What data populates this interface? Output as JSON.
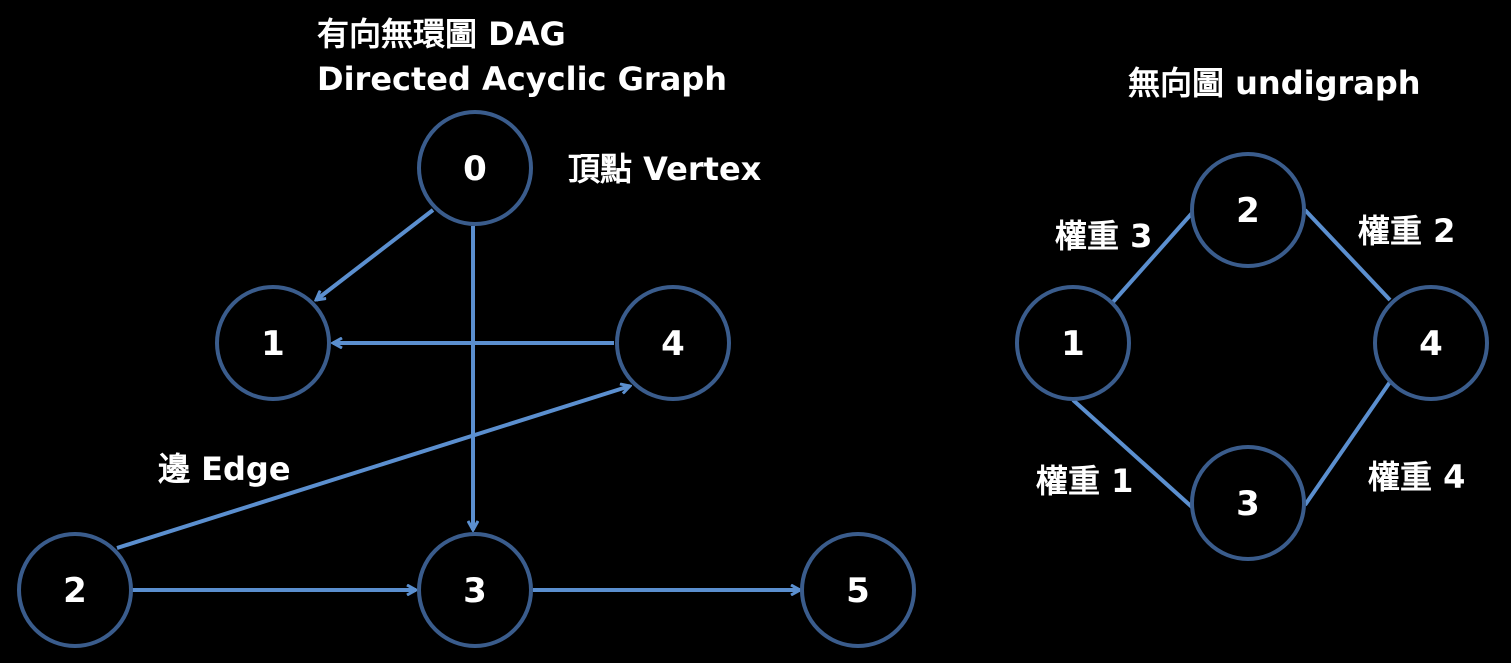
{
  "dag": {
    "title_line1": "有向無環圖 DAG",
    "title_line2": "Directed Acyclic Graph",
    "vertex_label": "頂點 Vertex",
    "edge_label": "邊 Edge",
    "nodes": [
      {
        "id": "0",
        "label": "0"
      },
      {
        "id": "1",
        "label": "1"
      },
      {
        "id": "4",
        "label": "4"
      },
      {
        "id": "2",
        "label": "2"
      },
      {
        "id": "3",
        "label": "3"
      },
      {
        "id": "5",
        "label": "5"
      }
    ],
    "edges": [
      {
        "from": "0",
        "to": "1"
      },
      {
        "from": "0",
        "to": "3"
      },
      {
        "from": "4",
        "to": "1"
      },
      {
        "from": "2",
        "to": "4"
      },
      {
        "from": "2",
        "to": "3"
      },
      {
        "from": "3",
        "to": "5"
      }
    ]
  },
  "undigraph": {
    "title": "無向圖 undigraph",
    "nodes": [
      {
        "id": "2",
        "label": "2"
      },
      {
        "id": "1",
        "label": "1"
      },
      {
        "id": "4",
        "label": "4"
      },
      {
        "id": "3",
        "label": "3"
      }
    ],
    "edges": [
      {
        "from": "1",
        "to": "2",
        "label": "權重 3"
      },
      {
        "from": "2",
        "to": "4",
        "label": "權重 2"
      },
      {
        "from": "1",
        "to": "3",
        "label": "權重 1"
      },
      {
        "from": "3",
        "to": "4",
        "label": "權重 4"
      }
    ]
  },
  "colors": {
    "background": "#000000",
    "node_stroke": "#3a5c8c",
    "edge": "#5b8fcf",
    "text": "#ffffff"
  }
}
